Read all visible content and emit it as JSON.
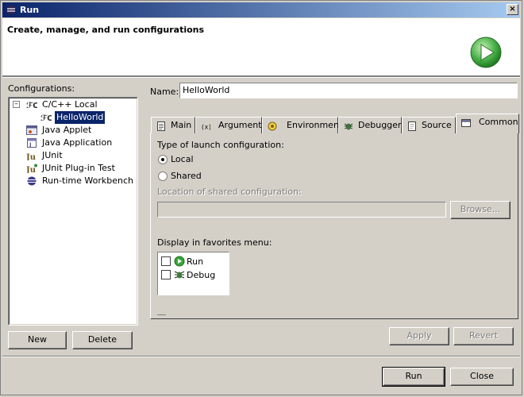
{
  "window": {
    "title": "Run",
    "close_glyph": "×"
  },
  "banner": {
    "title": "Create, manage, and run configurations",
    "icon": "run-large-icon",
    "accent": "#3aa53a"
  },
  "configurations": {
    "label": "Configurations:",
    "items": [
      {
        "label": "C/C++ Local",
        "icon": "cpp-config-icon"
      },
      {
        "label": "HelloWorld",
        "icon": "cpp-launch-icon",
        "selected": true
      },
      {
        "label": "Java Applet",
        "icon": "java-applet-icon"
      },
      {
        "label": "Java Application",
        "icon": "java-app-icon"
      },
      {
        "label": "JUnit",
        "icon": "junit-icon"
      },
      {
        "label": "JUnit Plug-in Test",
        "icon": "junit-plugin-icon"
      },
      {
        "label": "Run-time Workbench",
        "icon": "workbench-icon"
      }
    ],
    "new_label": "New",
    "delete_label": "Delete"
  },
  "name_field": {
    "label": "Name:",
    "value": "HelloWorld"
  },
  "tabs": [
    {
      "label": "Main",
      "icon": "main-tab-icon"
    },
    {
      "label": "Arguments",
      "icon": "arguments-tab-icon"
    },
    {
      "label": "Environment",
      "icon": "environment-tab-icon"
    },
    {
      "label": "Debugger",
      "icon": "debugger-tab-icon"
    },
    {
      "label": "Source",
      "icon": "source-tab-icon"
    },
    {
      "label": "Common",
      "icon": "common-tab-icon",
      "active": true
    }
  ],
  "common": {
    "launch_type_label": "Type of launch configuration:",
    "local_label": "Local",
    "shared_label": "Shared",
    "selected": "Local",
    "location_label": "Location of shared configuration:",
    "location_value": "",
    "browse_label": "Browse...",
    "favorites_label": "Display in favorites menu:",
    "favorites": [
      {
        "label": "Run",
        "checked": false,
        "icon": "run-small-icon"
      },
      {
        "label": "Debug",
        "checked": false,
        "icon": "debug-small-icon"
      }
    ]
  },
  "actions": {
    "apply_label": "Apply",
    "revert_label": "Revert",
    "run_label": "Run",
    "close_label": "Close"
  },
  "colors": {
    "selection": "#0a246a",
    "titlebar": "#0a246a",
    "face": "#d4d0c8"
  }
}
